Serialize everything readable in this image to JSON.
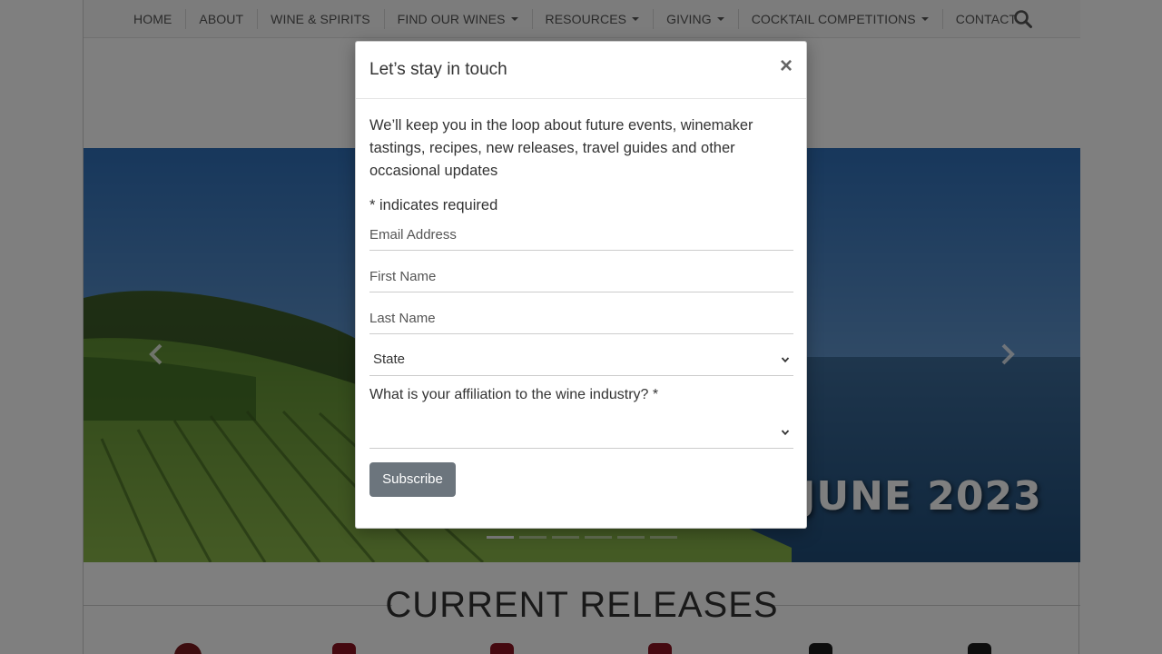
{
  "nav": {
    "items": [
      {
        "label": "HOME",
        "dropdown": false
      },
      {
        "label": "ABOUT",
        "dropdown": false
      },
      {
        "label": "WINE & SPIRITS",
        "dropdown": false
      },
      {
        "label": "FIND OUR WINES",
        "dropdown": true
      },
      {
        "label": "RESOURCES",
        "dropdown": true
      },
      {
        "label": "GIVING",
        "dropdown": true
      },
      {
        "label": "COCKTAIL COMPETITIONS",
        "dropdown": true
      },
      {
        "label": "CONTACT",
        "dropdown": false
      }
    ],
    "search_icon": "search-icon"
  },
  "carousel": {
    "banner_text": "JUNE 2023",
    "slide_count": 6,
    "active_index": 0
  },
  "releases": {
    "title": "CURRENT RELEASES"
  },
  "modal": {
    "title": "Let’s stay in touch",
    "close_label": "×",
    "intro": "We’ll keep you in the loop about future events, winemaker tastings, recipes, new releases, travel guides and other occasional updates",
    "required_note": "* indicates required",
    "email_placeholder": "Email Address",
    "first_name_placeholder": "First Name",
    "last_name_placeholder": "Last Name",
    "state_value": "State",
    "affiliation_question": "What is your affiliation to the wine industry? *",
    "affiliation_value": "",
    "subscribe_label": "Subscribe"
  },
  "colors": {
    "button_bg": "#6c757d",
    "backdrop": "rgba(0,0,0,0.5)",
    "sky": "#3f7fc0",
    "sea": "#2c5c8c"
  }
}
